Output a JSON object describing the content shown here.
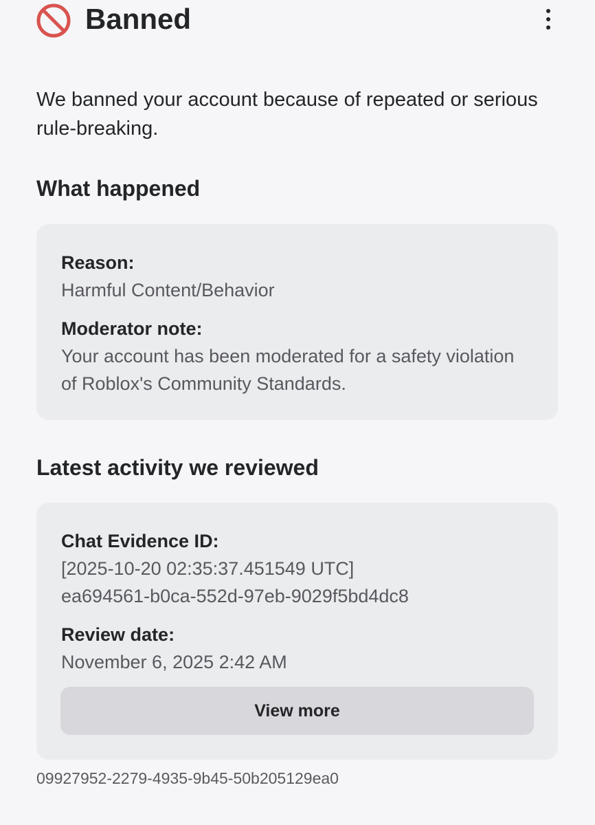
{
  "header": {
    "icon": "prohibited-icon",
    "title": "Banned",
    "menu_icon": "more-vertical-icon"
  },
  "intro": "We banned your account because of repeated or serious rule-breaking.",
  "what_happened": {
    "heading": "What happened",
    "reason_label": "Reason:",
    "reason_value": "Harmful Content/Behavior",
    "note_label": "Moderator note:",
    "note_value": "Your account has been moderated for a safety violation of Roblox's Community Standards."
  },
  "activity": {
    "heading": "Latest activity we reviewed",
    "evidence_label": "Chat Evidence ID:",
    "evidence_timestamp": "[2025-10-20 02:35:37.451549 UTC]",
    "evidence_id": "ea694561-b0ca-552d-97eb-9029f5bd4dc8",
    "review_label": "Review date:",
    "review_value": "November 6, 2025 2:42 AM",
    "view_more_label": "View more"
  },
  "footer_id": "09927952-2279-4935-9b45-50b205129ea0",
  "colors": {
    "ban_red": "#d9534f",
    "background": "#f6f6f8",
    "card": "#ebecee",
    "button": "#d8d8dc"
  }
}
